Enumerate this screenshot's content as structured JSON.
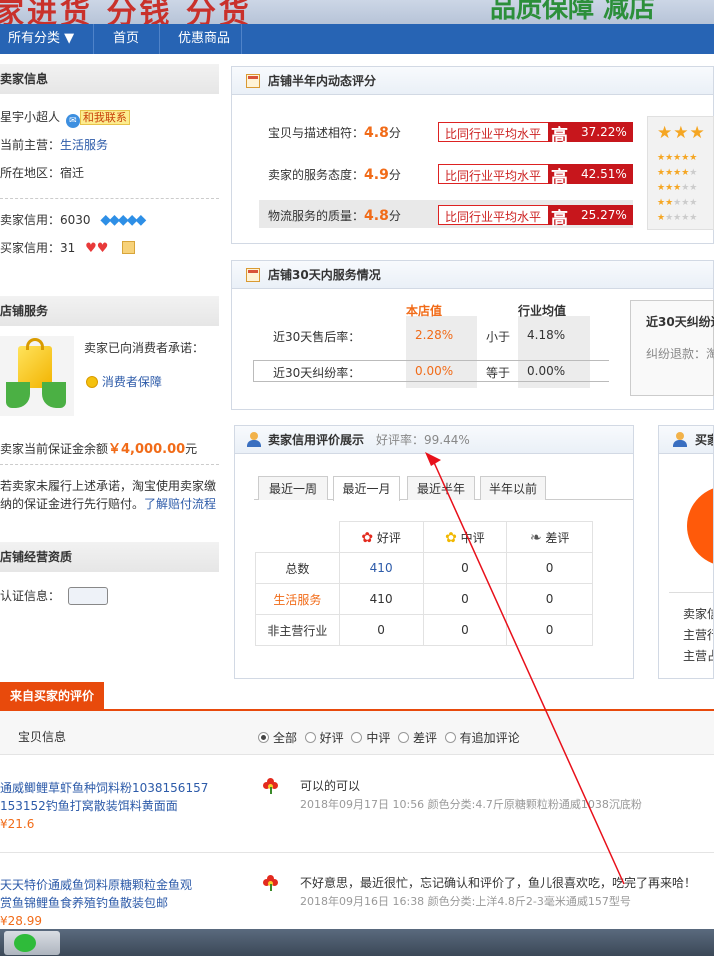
{
  "banner": {
    "text_left": "家进货  分钱  分货",
    "text_right": "品质保障  减店"
  },
  "nav": {
    "all_categories": "所有分类",
    "home": "首页",
    "deals": "优惠商品"
  },
  "seller_info": {
    "title": "卖家信息",
    "name": "星宇小超人",
    "contact": "和我联系",
    "category_label": "当前主营：",
    "category": "生活服务",
    "region_label": "所在地区：",
    "region": "宿迁",
    "seller_credit_label": "卖家信用：",
    "seller_credit": "6030",
    "buyer_credit_label": "买家信用：",
    "buyer_credit": "31"
  },
  "shop_service": {
    "title": "店铺服务",
    "promise": "卖家已向消费者承诺：",
    "guarantee": "消费者保障",
    "deposit_label": "卖家当前保证金余额",
    "deposit_amount": "￥4,000.00",
    "deposit_unit": "元",
    "notice_line1": "若卖家未履行上述承诺，淘宝使用卖家缴",
    "notice_line2": "纳的保证金进行先行赔付。",
    "notice_link": "了解赔付流程"
  },
  "qualification": {
    "title": "店铺经营资质",
    "cert_label": "认证信息："
  },
  "dsr": {
    "title": "店铺半年内动态评分",
    "rows": [
      {
        "label": "宝贝与描述相符：",
        "score": "4.8",
        "unit": "分",
        "compare": "比同行业平均水平",
        "level": "高",
        "percent": "37.22%"
      },
      {
        "label": "卖家的服务态度：",
        "score": "4.9",
        "unit": "分",
        "compare": "比同行业平均水平",
        "level": "高",
        "percent": "42.51%"
      },
      {
        "label": "物流服务的质量：",
        "score": "4.8",
        "unit": "分",
        "compare": "比同行业平均水平",
        "level": "高",
        "percent": "25.27%"
      }
    ]
  },
  "service30": {
    "title": "店铺30天内服务情况",
    "col_store": "本店值",
    "col_industry": "行业均值",
    "rows": [
      {
        "label": "近30天售后率：",
        "store": "2.28%",
        "relation": "小于",
        "industry": "4.18%"
      },
      {
        "label": "近30天纠纷率：",
        "store": "0.00%",
        "relation": "等于",
        "industry": "0.00%"
      }
    ],
    "side_title": "近30天纠纷退",
    "side_text": "纠纷退款：淘"
  },
  "credit": {
    "title": "卖家信用评价展示",
    "good_rate_label": "好评率：",
    "good_rate": "99.44%",
    "tabs": [
      "最近一周",
      "最近一月",
      "最近半年",
      "半年以前"
    ],
    "active_tab": "最近一月",
    "headers": [
      "好评",
      "中评",
      "差评"
    ],
    "rows": [
      {
        "name": "总数",
        "good": "410",
        "mid": "0",
        "bad": "0"
      },
      {
        "name": "生活服务",
        "good": "410",
        "mid": "0",
        "bad": "0"
      },
      {
        "name": "非主营行业",
        "good": "0",
        "mid": "0",
        "bad": "0"
      }
    ]
  },
  "buyer_credit_panel": {
    "title": "买家",
    "lines": [
      "卖家信",
      "主营行",
      "主营占"
    ]
  },
  "reviews": {
    "tab": "来自买家的评价",
    "col_item": "宝贝信息",
    "filters": [
      "全部",
      "好评",
      "中评",
      "差评",
      "有追加评论"
    ],
    "items": [
      {
        "title_line1": "通威鲫鲤草虾鱼种饲料粉1038156157",
        "title_line2": "153152钓鱼打窝散装饵料黄面面",
        "price": "¥21.6",
        "comment": "可以的可以",
        "meta": "2018年09月17日 10:56 颜色分类:4.7斤原糖颗粒粉通威1038沉底粉"
      },
      {
        "title_line1": "天天特价通威鱼饲料原糖颗粒金鱼观",
        "title_line2": "赏鱼锦鲤鱼食养殖钓鱼散装包邮",
        "price": "¥28.99",
        "comment": "不好意思，最近很忙，忘记确认和评价了，鱼儿很喜欢吃，吃完了再来哈！",
        "meta": "2018年09月16日 16:38 颜色分类:上洋4.8斤2-3毫米通威157型号"
      }
    ]
  },
  "colors": {
    "nav": "#2764b4",
    "accent": "#f16b18",
    "red": "#c7161c",
    "link": "#2d5ba9",
    "review_tab": "#e84a0c"
  }
}
